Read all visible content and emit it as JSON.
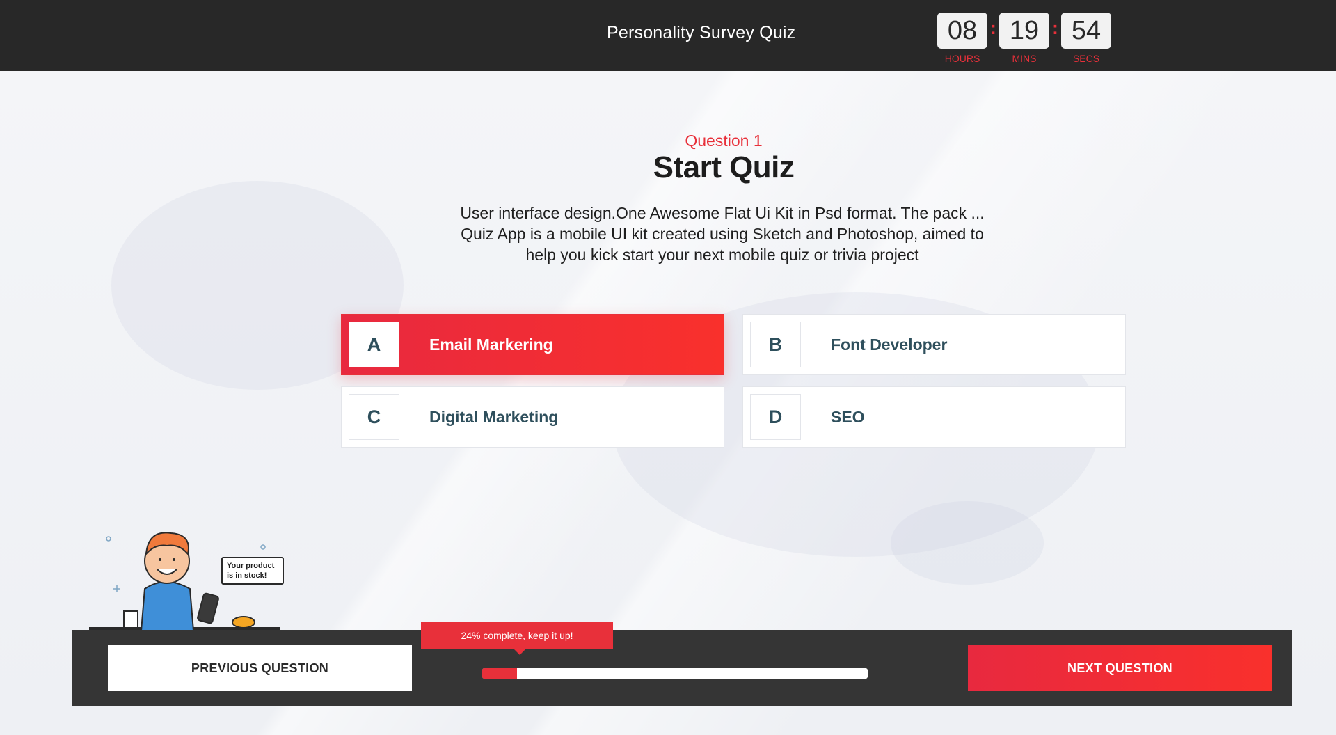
{
  "header": {
    "title": "Personality Survey Quiz",
    "timer": [
      {
        "value": "08",
        "label": "HOURS"
      },
      {
        "value": "19",
        "label": "MINS"
      },
      {
        "value": "54",
        "label": "SECS"
      }
    ],
    "separator": ":"
  },
  "question": {
    "number_label": "Question 1",
    "title": "Start Quiz",
    "description": "User interface design.One Awesome Flat Ui Kit in Psd format. The pack ... Quiz App is a mobile UI kit created using Sketch and Photoshop, aimed to help you kick start your next mobile quiz or trivia project"
  },
  "options": [
    {
      "letter": "A",
      "label": "Email Markering",
      "selected": true
    },
    {
      "letter": "B",
      "label": "Font Developer",
      "selected": false
    },
    {
      "letter": "C",
      "label": "Digital Marketing",
      "selected": false
    },
    {
      "letter": "D",
      "label": "SEO",
      "selected": false
    }
  ],
  "illustration": {
    "speech_line1": "Your product",
    "speech_line2": "is in stock!"
  },
  "footer": {
    "prev_label": "PREVIOUS QUESTION",
    "next_label": "NEXT QUESTION",
    "progress_text": "24% complete, keep it up!",
    "progress_percent": 9
  },
  "colors": {
    "accent": "#e8303a",
    "header_bg": "#282828",
    "footer_bg": "#353535"
  }
}
